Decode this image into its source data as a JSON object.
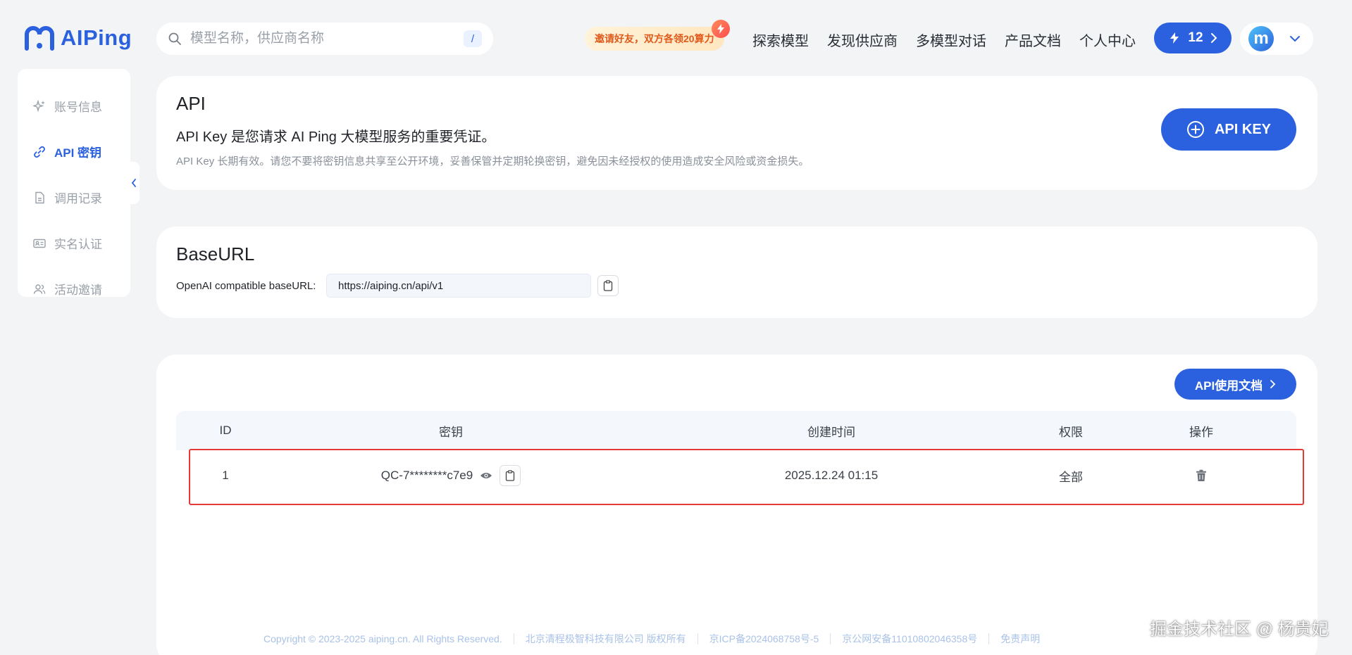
{
  "logo": {
    "text": "AIPing"
  },
  "search": {
    "placeholder": "模型名称，供应商名称",
    "shortcut": "/"
  },
  "invite": {
    "label": "邀请好友，双方各领20算力"
  },
  "nav": [
    "探索模型",
    "发现供应商",
    "多模型对话",
    "产品文档",
    "个人中心"
  ],
  "credits": {
    "value": "12"
  },
  "user": {
    "avatar_letter": "m"
  },
  "sidebar": {
    "items": [
      {
        "label": "账号信息",
        "icon": "sparkle-icon"
      },
      {
        "label": "API 密钥",
        "icon": "link-icon",
        "active": true
      },
      {
        "label": "调用记录",
        "icon": "file-icon"
      },
      {
        "label": "实名认证",
        "icon": "id-card-icon"
      },
      {
        "label": "活动邀请",
        "icon": "people-icon"
      }
    ]
  },
  "api_card": {
    "title": "API",
    "description": "API Key 是您请求 AI Ping 大模型服务的重要凭证。",
    "note": "API Key 长期有效。请您不要将密钥信息共享至公开环境，妥善保管并定期轮换密钥，避免因未经授权的使用造成安全风险或资金损失。",
    "button": "API KEY"
  },
  "base_card": {
    "title": "BaseURL",
    "label": "OpenAI compatible baseURL:",
    "url": "https://aiping.cn/api/v1"
  },
  "keys_card": {
    "docs_button": "API使用文档",
    "columns": [
      "ID",
      "密钥",
      "创建时间",
      "权限",
      "操作"
    ],
    "rows": [
      {
        "id": "1",
        "key": "QC-7********c7e9",
        "created": "2025.12.24 01:15",
        "permission": "全部"
      }
    ]
  },
  "footer": {
    "items": [
      "Copyright © 2023-2025 aiping.cn. All Rights Reserved.",
      "北京清程极智科技有限公司 版权所有",
      "京ICP备2024068758号-5",
      "京公网安备11010802046358号",
      "免责声明"
    ]
  },
  "watermark": "掘金技术社区 @ 杨贵妃",
  "colors": {
    "primary": "#2b61de",
    "highlight": "#e53935"
  }
}
